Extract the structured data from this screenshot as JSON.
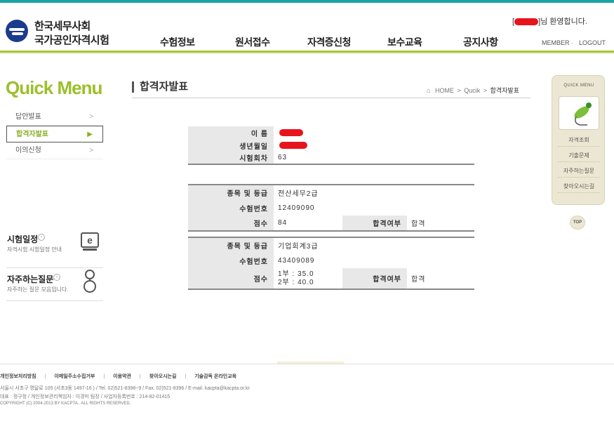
{
  "header": {
    "logo_line1": "한국세무사회",
    "logo_line2": "국가공인자격시험",
    "welcome_open": "[",
    "welcome_suffix": "]님 환영합니다.",
    "util_member": "MEMBER",
    "util_logout": "LOGOUT",
    "accent_color": "#a9c23b"
  },
  "gnb": {
    "items": [
      "수험정보",
      "원서접수",
      "자격증신청",
      "보수교육",
      "공지사항"
    ]
  },
  "lnb": {
    "title": "Quick Menu",
    "items": [
      {
        "label": "답안발표",
        "arrow": ">"
      },
      {
        "label": "합격자발표",
        "arrow": "▶",
        "active": true
      },
      {
        "label": "이의신청",
        "arrow": ">"
      }
    ],
    "box1_title": "시험일정",
    "box1_sub": "자격시험 시험일정 안내",
    "box2_title": "자주하는질문",
    "box2_sub": "자주하는 질문 모음입니다."
  },
  "content": {
    "page_title": "합격자발표",
    "breadcrumb_home": "HOME",
    "breadcrumb_sep": ">",
    "breadcrumb_quick": "Qucik",
    "breadcrumb_current": "합격자발표",
    "personal": {
      "name_label": "이 름",
      "birth_label": "생년월일",
      "round_label": "시험회차",
      "round_value": "63"
    },
    "result1": {
      "category_label": "종목 및 등급",
      "category_value": "전산세무2급",
      "exam_no_label": "수험번호",
      "exam_no_value": "12409090",
      "score_label": "점수",
      "score_value": "84",
      "pass_label": "합격여부",
      "pass_value": "합격"
    },
    "result2": {
      "category_label": "종목 및 등급",
      "category_value": "기업회계3급",
      "exam_no_label": "수험번호",
      "exam_no_value": "43409089",
      "score_label": "점수",
      "score_value_1": "1부 : 35.0",
      "score_value_2": "2부 : 40.0",
      "pass_label": "합격여부",
      "pass_value": "합격"
    }
  },
  "quick_bar": {
    "title": "QUICK MENU",
    "items": [
      "자격조회",
      "기출문제",
      "자주하는질문",
      "찾아오시는길"
    ],
    "top": "TOP"
  },
  "footer": {
    "links": [
      "개인정보처리방침",
      "이메일주소수집거부",
      "이용약관",
      "찾아오시는길",
      "기술감독 온라인교육"
    ],
    "link_sep": "|",
    "address": "서울시 서초구 명달로 105 (서초3동 1497-16 ) / Tel. 02)521-8398~9 / Fax. 02)521-8396 / E-mail. kacpta@kacpta.or.kr",
    "representative": "대표 : 정구정 / 개인정보관리책임자 : 이경미 팀장 / 사업자등록번호 : 214-82-01415",
    "copyright": "COPYRIGHT (C) 2004-2013 BY KACPTA.. ALL RIGHTS RESERVED."
  }
}
